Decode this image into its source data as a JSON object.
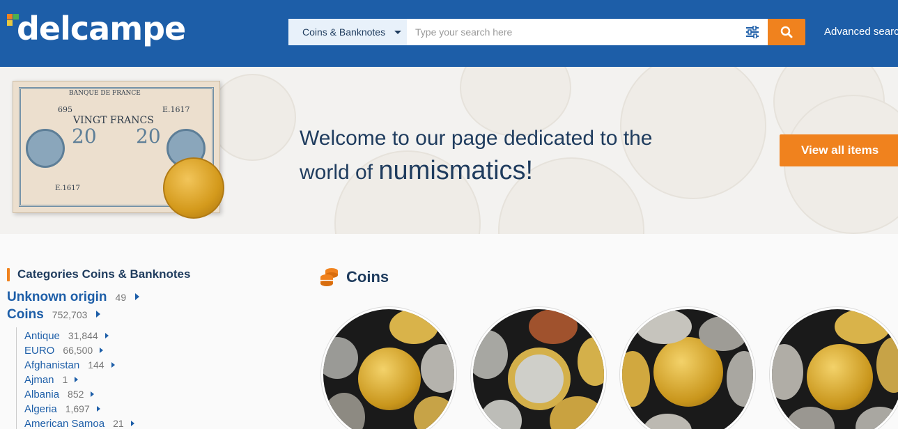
{
  "header": {
    "logo_text": "delcampe",
    "search": {
      "category": "Coins & Banknotes",
      "placeholder": "Type your search here"
    },
    "advanced_link": "Advanced search"
  },
  "banner": {
    "note": {
      "top_number": "695",
      "serial": "E.1617",
      "serial_bottom": "E.1617",
      "bank": "BANQUE DE FRANCE",
      "title": "VINGT FRANCS",
      "value_left": "20",
      "value_right": "20"
    },
    "welcome_line1": "Welcome to our page dedicated to the",
    "welcome_line2a": "world of ",
    "welcome_big": "numismatics",
    "welcome_end": "!",
    "view_button": "View all items"
  },
  "sidebar": {
    "title": "Categories Coins & Banknotes",
    "top_categories": [
      {
        "name": "Unknown origin",
        "count": "49"
      },
      {
        "name": "Coins",
        "count": "752,703"
      }
    ],
    "sub_categories": [
      {
        "name": "Antique",
        "count": "31,844"
      },
      {
        "name": "EURO",
        "count": "66,500"
      },
      {
        "name": "Afghanistan",
        "count": "144"
      },
      {
        "name": "Ajman",
        "count": "1"
      },
      {
        "name": "Albania",
        "count": "852"
      },
      {
        "name": "Algeria",
        "count": "1,697"
      },
      {
        "name": "American Samoa",
        "count": "21"
      }
    ]
  },
  "main": {
    "section_title": "Coins"
  },
  "colors": {
    "header_blue": "#1d5ea8",
    "accent_orange": "#f0821e",
    "text_navy": "#1f3c5e"
  }
}
